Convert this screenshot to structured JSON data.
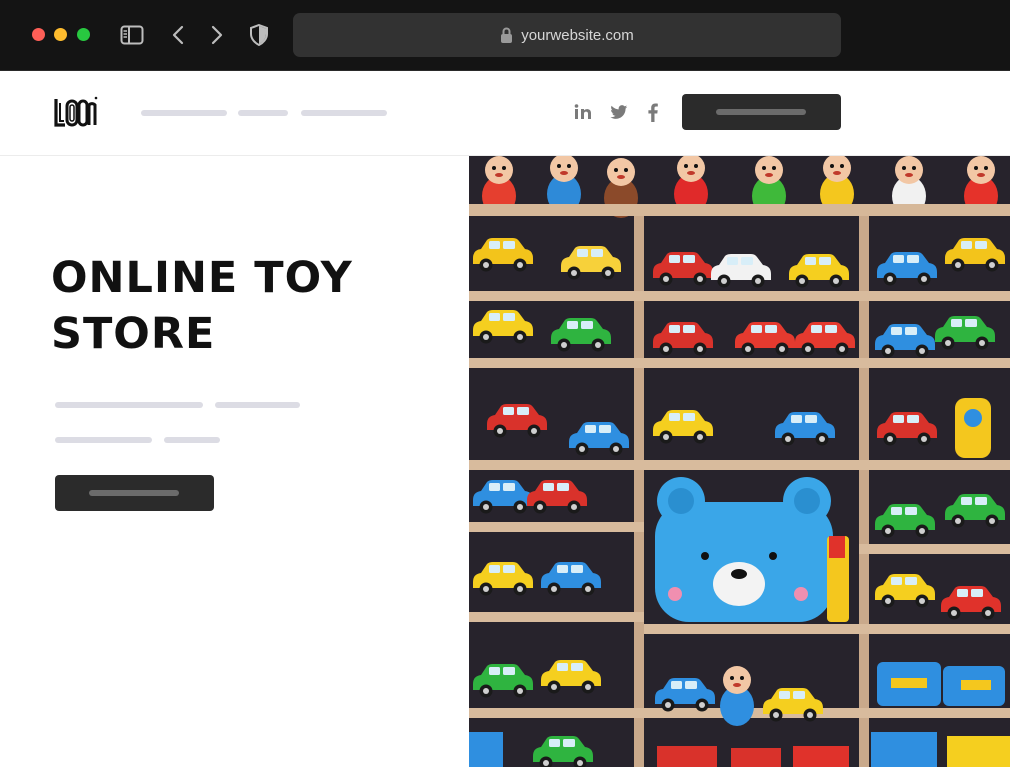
{
  "browser": {
    "url": "yourwebsite.com",
    "icons": [
      "sidebar-icon",
      "back-icon",
      "forward-icon",
      "shield-icon",
      "lock-icon"
    ]
  },
  "header": {
    "logo_text": "LOGO",
    "social": [
      {
        "name": "linkedin-icon",
        "glyph": "in"
      },
      {
        "name": "twitter-icon",
        "glyph": "twitter"
      },
      {
        "name": "facebook-icon",
        "glyph": "f"
      }
    ]
  },
  "hero": {
    "title_line1": "ONLINE TOY",
    "title_line2": "STORE",
    "image_subject": "shelves of colorful toy cars, plush toys and a blue bear toy box"
  },
  "colors": {
    "chrome_bg": "#141414",
    "urlbar_bg": "#323232",
    "placeholder_line": "#dcdce4",
    "button_bg": "#2b2b2b",
    "button_bar": "#6b6b6b",
    "title_text": "#111111"
  }
}
